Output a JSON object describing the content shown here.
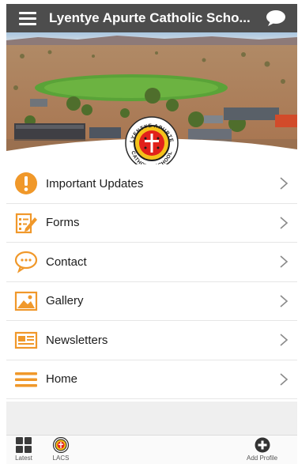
{
  "app_bar": {
    "title": "Lyentye Apurte Catholic Scho...",
    "menu_icon": "hamburger-icon",
    "chat_icon": "chat-bubble-icon"
  },
  "hero": {
    "badge_top_text": "LYENTYE APURTE",
    "badge_bottom_text": "CATHOLIC SCHOOL"
  },
  "menu": {
    "items": [
      {
        "label": "Important Updates",
        "icon": "alert-icon"
      },
      {
        "label": "Forms",
        "icon": "form-icon"
      },
      {
        "label": "Contact",
        "icon": "chat-icon"
      },
      {
        "label": "Gallery",
        "icon": "gallery-icon"
      },
      {
        "label": "Newsletters",
        "icon": "newsletter-icon"
      },
      {
        "label": "Home",
        "icon": "home-menu-icon"
      }
    ]
  },
  "tab_bar": {
    "latest": "Latest",
    "lacs": "LACS",
    "add_profile": "Add Profile"
  },
  "colors": {
    "app_bar": "#4d4d4d",
    "accent": "#f0982a"
  }
}
